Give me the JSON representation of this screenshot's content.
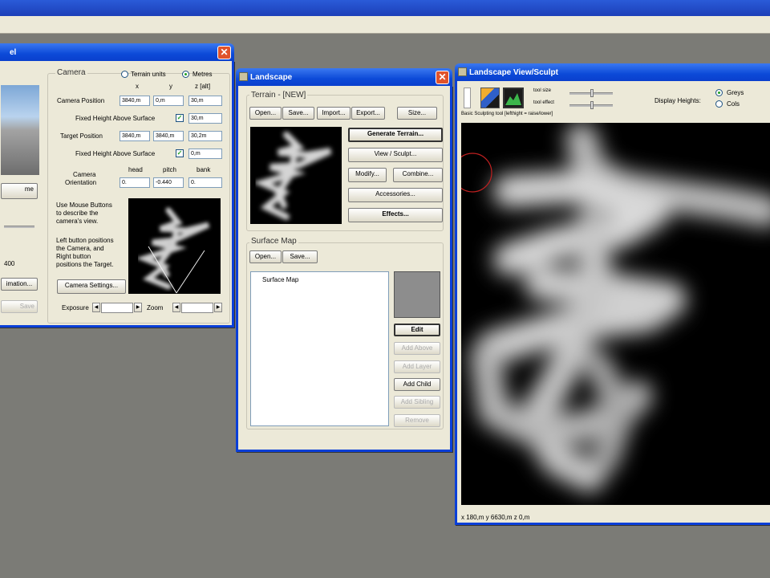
{
  "camera_window": {
    "title": "el",
    "camera_group": "Camera",
    "terrain_units": "Terrain units",
    "metres": "Metres",
    "col_x": "x",
    "col_y": "y",
    "col_z": "z [alt]",
    "camera_position_label": "Camera Position",
    "camera_pos": [
      "3840,m",
      "0,m",
      "30,m"
    ],
    "fixed_height_label": "Fixed Height Above Surface",
    "fixed_height_camera": "30,m",
    "target_position_label": "Target Position",
    "target_pos": [
      "3840,m",
      "3840,m",
      "30,2m"
    ],
    "fixed_height_target": "0,m",
    "orientation_label_1": "Camera",
    "orientation_label_2": "Orientation",
    "head": "head",
    "pitch": "pitch",
    "bank": "bank",
    "orient_vals": [
      "0.",
      "-0.440",
      "0."
    ],
    "help_1": "Use Mouse Buttons",
    "help_2": "to describe the",
    "help_3": "camera's view.",
    "help_4": "Left button positions",
    "help_5": "the Camera, and",
    "help_6": "Right button",
    "help_7": "positions the Target.",
    "camera_settings_btn": "Camera Settings...",
    "exposure": "Exposure",
    "zoom": "Zoom",
    "left_btn": "me",
    "left_num": "400",
    "left_btn2": "imation...",
    "left_btn3": "Save"
  },
  "landscape_window": {
    "title": "Landscape",
    "terrain_group": "Terrain - [NEW]",
    "open": "Open...",
    "save": "Save...",
    "import": "Import...",
    "export": "Export...",
    "size": "Size...",
    "generate": "Generate Terrain...",
    "view_sculpt": "View / Sculpt...",
    "modify": "Modify...",
    "combine": "Combine...",
    "accessories": "Accessories...",
    "effects": "Effects...",
    "surface_group": "Surface Map",
    "s_open": "Open...",
    "s_save": "Save...",
    "tree_item": "Surface Map",
    "edit": "Edit",
    "add_above": "Add Above",
    "add_layer": "Add Layer",
    "add_child": "Add Child",
    "add_sibling": "Add Sibling",
    "remove": "Remove"
  },
  "sculpt_window": {
    "title": "Landscape View/Sculpt",
    "tool_size": "tool size",
    "tool_effect": "tool effect",
    "display_heights": "Display Heights:",
    "greys": "Greys",
    "cols": "Cols",
    "status_tool": "Basic Sculpting tool [lefthight = raise/lower]",
    "coords": "x 180,m   y 6630,m   z 0,m"
  }
}
